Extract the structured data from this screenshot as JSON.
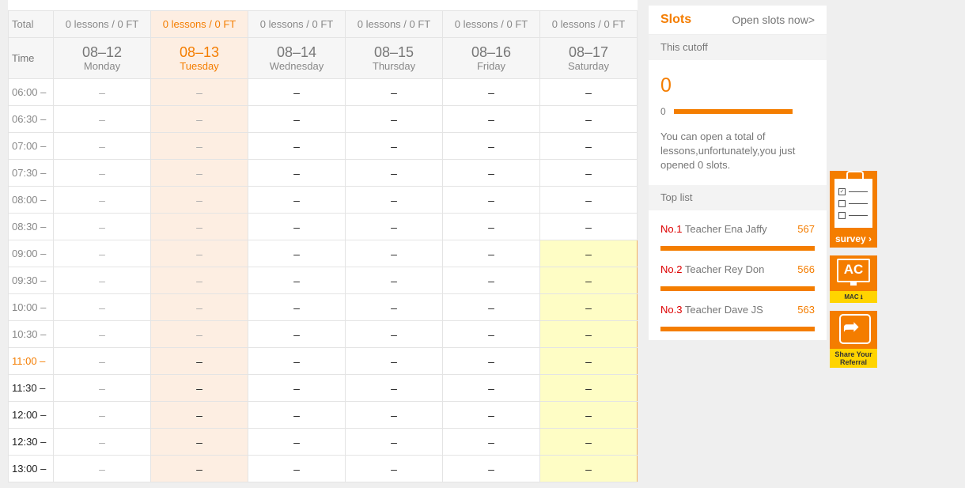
{
  "schedule": {
    "total_label": "Total",
    "time_label": "Time",
    "totals": [
      "0 lessons / 0 FT",
      "0 lessons / 0 FT",
      "0 lessons / 0 FT",
      "0 lessons / 0 FT",
      "0 lessons / 0 FT",
      "0 lessons / 0 FT"
    ],
    "days": [
      {
        "date": "08–12",
        "weekday": "Monday"
      },
      {
        "date": "08–13",
        "weekday": "Tuesday"
      },
      {
        "date": "08–14",
        "weekday": "Wednesday"
      },
      {
        "date": "08–15",
        "weekday": "Thursday"
      },
      {
        "date": "08–16",
        "weekday": "Friday"
      },
      {
        "date": "08–17",
        "weekday": "Saturday"
      }
    ],
    "times": [
      "06:00 –",
      "06:30 –",
      "07:00 –",
      "07:30 –",
      "08:00 –",
      "08:30 –",
      "09:00 –",
      "09:30 –",
      "10:00 –",
      "10:30 –",
      "11:00 –",
      "11:30 –",
      "12:00 –",
      "12:30 –",
      "13:00 –"
    ],
    "cell_value": "–"
  },
  "slots": {
    "title": "Slots",
    "open_link": "Open slots now>",
    "cutoff_label": "This cutoff",
    "count": "0",
    "progress_label": "0",
    "progress_fraction": 1.0,
    "message": "You can open a total of lessons,unfortunately,you just opened 0 slots.",
    "top_list_label": "Top list",
    "ranks": [
      {
        "no": "No.1",
        "teacher": "Teacher Ena Jaffy",
        "score": "567"
      },
      {
        "no": "No.2",
        "teacher": "Teacher Rey Don",
        "score": "566"
      },
      {
        "no": "No.3",
        "teacher": "Teacher Dave JS",
        "score": "563"
      }
    ]
  },
  "sidebar": {
    "survey_label": "survey ›",
    "mac_icon_text": "AC",
    "mac_label": "MAC ⭳",
    "share_label": "Share Your Referral",
    "share_arrow": "➦"
  },
  "colors": {
    "accent": "#f47d00",
    "highlight": "#fefdc5",
    "today": "#fdeee2",
    "strip": "#ffd400",
    "rank_no": "#dd0000"
  }
}
